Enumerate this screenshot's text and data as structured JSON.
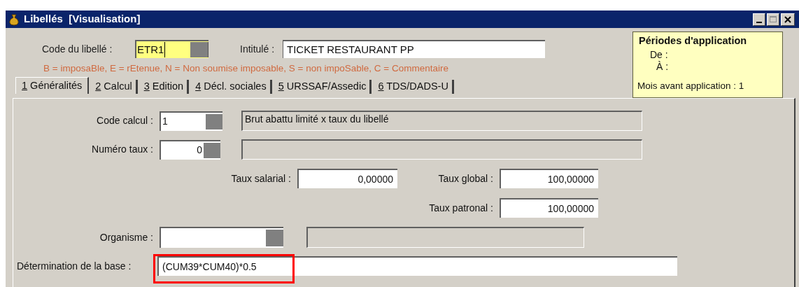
{
  "window": {
    "title": "Libellés  [Visualisation]"
  },
  "code": {
    "label": "Code du libellé :",
    "value": "ETR1"
  },
  "intitule": {
    "label": "Intitulé :",
    "value": "TICKET RESTAURANT PP"
  },
  "legend": "B = imposaBle, E = rEtenue, N = Non soumise imposable, S = non impoSable, C = Commentaire",
  "periods": {
    "title": "Périodes d'application",
    "from": "De :",
    "to": "À :",
    "months": "Mois avant application : 1"
  },
  "tabs": [
    {
      "key": "1",
      "label": " Généralités",
      "selected": true
    },
    {
      "key": "2",
      "label": " Calcul",
      "selected": false
    },
    {
      "key": "3",
      "label": " Edition",
      "selected": false
    },
    {
      "key": "4",
      "label": " Décl. sociales",
      "selected": false
    },
    {
      "key": "5",
      "label": " URSSAF/Assedic",
      "selected": false
    },
    {
      "key": "6",
      "label": " TDS/DADS-U",
      "selected": false
    }
  ],
  "code_calcul": {
    "label": "Code calcul :",
    "value": "1",
    "description": "Brut abattu limité x taux du libellé"
  },
  "numero_taux": {
    "label": "Numéro taux :",
    "value": "0"
  },
  "taux_salarial": {
    "label": "Taux salarial :",
    "value": "0,00000"
  },
  "taux_global": {
    "label": "Taux global :",
    "value": "100,00000"
  },
  "taux_patronal": {
    "label": "Taux patronal :",
    "value": "100,00000"
  },
  "organisme": {
    "label": "Organisme :"
  },
  "base": {
    "label": "Détermination de la base :",
    "value": "(CUM39*CUM40)*0.5",
    "highlighted": true
  }
}
